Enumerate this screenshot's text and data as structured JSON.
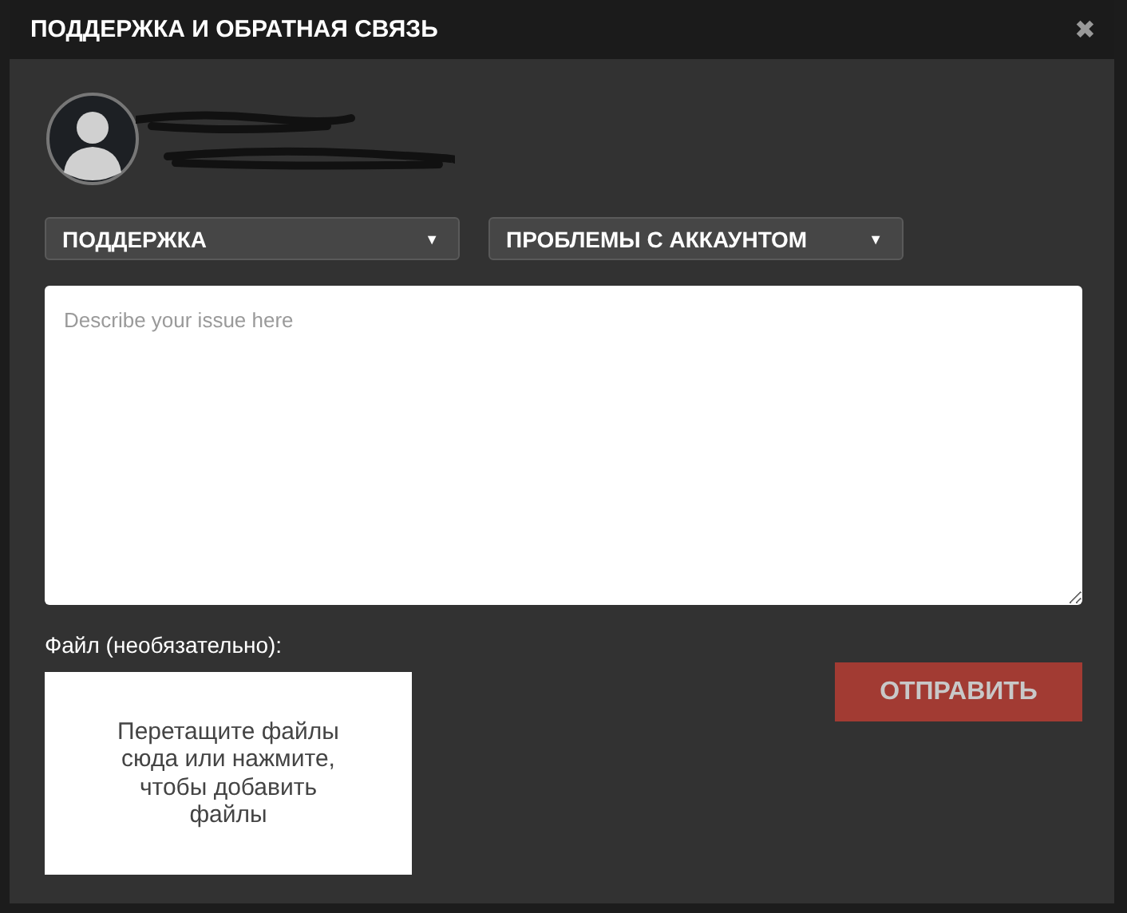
{
  "window": {
    "title": "ПОДДЕРЖКА И ОБРАТНАЯ СВЯЗЬ",
    "close": "✖"
  },
  "dropdowns": [
    {
      "value": "ПОДДЕРЖКА",
      "caret": "▼"
    },
    {
      "value": "ПРОБЛЕМЫ С АККАУНТОМ",
      "caret": "▼"
    }
  ],
  "issue": {
    "placeholder": "Describe your issue here"
  },
  "file": {
    "label": "Файл (необязательно):",
    "dropzone": "Перетащите файлы сюда или нажмите, чтобы добавить файлы"
  },
  "submit": "ОТПРАВИТЬ"
}
